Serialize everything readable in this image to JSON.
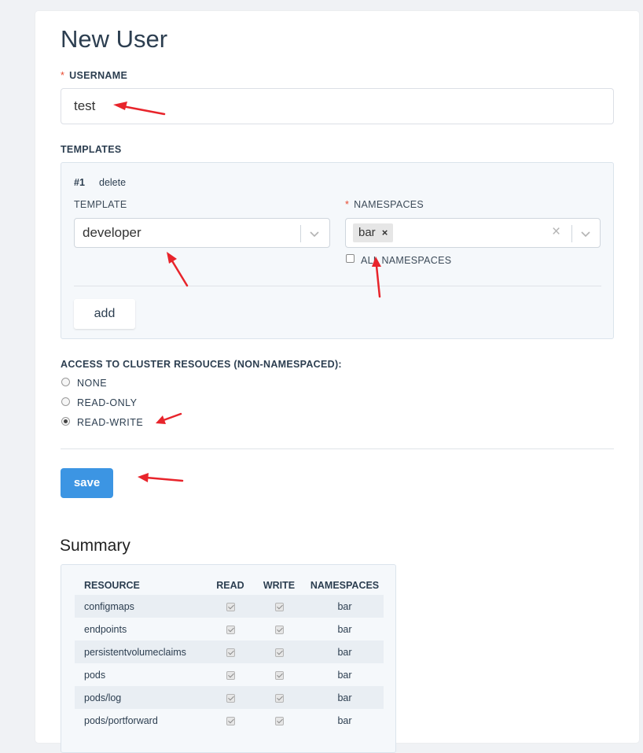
{
  "page": {
    "title": "New User"
  },
  "username": {
    "label": "USERNAME",
    "required_mark": "*",
    "value": "test"
  },
  "templates": {
    "label": "TEMPLATES",
    "items": [
      {
        "index": "#1",
        "delete_label": "delete",
        "template_label": "TEMPLATE",
        "template_value": "developer",
        "namespaces_label": "NAMESPACES",
        "namespaces_required_mark": "*",
        "namespace_tags": [
          "bar"
        ],
        "tag_remove_glyph": "×",
        "clear_glyph": "×",
        "all_namespaces_label": "ALL NAMESPACES",
        "all_namespaces_checked": false
      }
    ],
    "add_label": "add"
  },
  "access": {
    "label": "ACCESS TO CLUSTER RESOUCES (NON-NAMESPACED):",
    "options": [
      {
        "label": "NONE",
        "checked": false
      },
      {
        "label": "READ-ONLY",
        "checked": false
      },
      {
        "label": "READ-WRITE",
        "checked": true
      }
    ]
  },
  "save_label": "save",
  "summary": {
    "title": "Summary",
    "columns": [
      "RESOURCE",
      "READ",
      "WRITE",
      "NAMESPACES"
    ],
    "rows": [
      {
        "resource": "configmaps",
        "read": true,
        "write": true,
        "namespaces": "bar"
      },
      {
        "resource": "endpoints",
        "read": true,
        "write": true,
        "namespaces": "bar"
      },
      {
        "resource": "persistentvolumeclaims",
        "read": true,
        "write": true,
        "namespaces": "bar"
      },
      {
        "resource": "pods",
        "read": true,
        "write": true,
        "namespaces": "bar"
      },
      {
        "resource": "pods/log",
        "read": true,
        "write": true,
        "namespaces": "bar"
      },
      {
        "resource": "pods/portforward",
        "read": true,
        "write": true,
        "namespaces": "bar"
      }
    ]
  },
  "colors": {
    "accent": "#3c95e3",
    "required": "#e8492f",
    "annotation_arrow": "#e8242b"
  }
}
